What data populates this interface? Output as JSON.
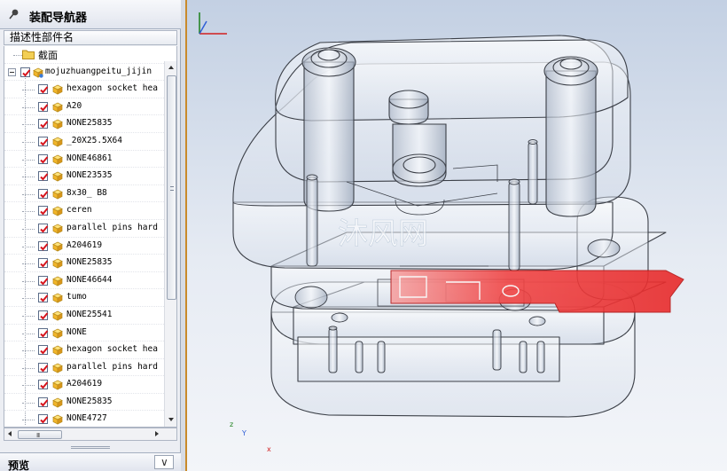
{
  "navigator": {
    "title": "装配导航器",
    "column_header": "描述性部件名",
    "section_node": "截面",
    "root_node": "mojuzhuangpeitu_jijin",
    "items": [
      "hexagon socket hea",
      "A20",
      "NONE25835",
      "_20X25.5X64",
      "NONE46861",
      "NONE23535",
      "8x30_ B8",
      "ceren",
      "parallel pins hard",
      "A204619",
      "NONE25835",
      "NONE46644",
      "tumo",
      "NONE25541",
      "NONE",
      "hexagon socket hea",
      "parallel pins hard",
      "A204619",
      "NONE25835",
      "NONE4727"
    ],
    "hscroll_grip": "III"
  },
  "preview": {
    "title": "预览",
    "toggle_glyph": "∨"
  },
  "viewport": {
    "watermark": "沐风网",
    "triad": {
      "x": "x",
      "y": "Y",
      "z": "z"
    },
    "colors": {
      "strip": "#f04545",
      "border": "#c98a2a"
    }
  }
}
